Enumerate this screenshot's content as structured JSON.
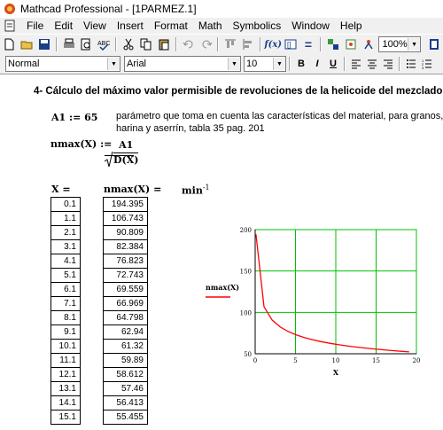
{
  "window": {
    "title": "Mathcad Professional - [1PARMEZ.1]"
  },
  "menu": [
    "File",
    "Edit",
    "View",
    "Insert",
    "Format",
    "Math",
    "Symbolics",
    "Window",
    "Help"
  ],
  "toolbar": {
    "zoom": "100%"
  },
  "formatbar": {
    "style": "Normal",
    "font": "Arial",
    "size": "10",
    "bold": "B",
    "italic": "I",
    "underline": "U"
  },
  "doc": {
    "heading": "4- Cálculo del máximo valor permisible de revoluciones de la helicoide del mezclador",
    "a1_def": "A1 := 65",
    "a1_desc": "parámetro que toma en cuenta las características del material, para granos, harina y aserrín, tabla 35 pag. 201",
    "nmax_lhs": "nmax(X) :=",
    "nmax_num": "A1",
    "nmax_den": "D(X)",
    "x_label": "X =",
    "nmax_label": "nmax(X) =",
    "unit": "min",
    "unit_exp": "-1"
  },
  "table": {
    "x": [
      "0.1",
      "1.1",
      "2.1",
      "3.1",
      "4.1",
      "5.1",
      "6.1",
      "7.1",
      "8.1",
      "9.1",
      "10.1",
      "11.1",
      "12.1",
      "13.1",
      "14.1",
      "15.1"
    ],
    "nmax": [
      "194.395",
      "106.743",
      "90.809",
      "82.384",
      "76.823",
      "72.743",
      "69.559",
      "66.969",
      "64.798",
      "62.94",
      "61.32",
      "59.89",
      "58.612",
      "57.46",
      "56.413",
      "55.455"
    ]
  },
  "chart_data": {
    "type": "line",
    "xlabel": "X",
    "ylabel": "nmax(X)",
    "xlim": [
      0,
      20
    ],
    "ylim": [
      50,
      200
    ],
    "x_ticks": [
      "0",
      "5",
      "10",
      "15",
      "20"
    ],
    "y_ticks": [
      "50",
      "100",
      "150",
      "200"
    ],
    "grid": true,
    "series": [
      {
        "name": "nmax(X)",
        "color": "#ff0000",
        "x": [
          0.1,
          1.1,
          2.1,
          3.1,
          4.1,
          5.1,
          6.1,
          7.1,
          8.1,
          9.1,
          10.1,
          11.1,
          12.1,
          13.1,
          14.1,
          15.1,
          16.1,
          17.1,
          18.1,
          19.1
        ],
        "y": [
          194.395,
          106.743,
          90.809,
          82.384,
          76.823,
          72.743,
          69.559,
          66.969,
          64.798,
          62.94,
          61.32,
          59.89,
          58.612,
          57.46,
          56.413,
          55.455,
          54.57,
          53.75,
          52.99,
          52.28
        ]
      }
    ],
    "grid_color": "#00c000"
  }
}
